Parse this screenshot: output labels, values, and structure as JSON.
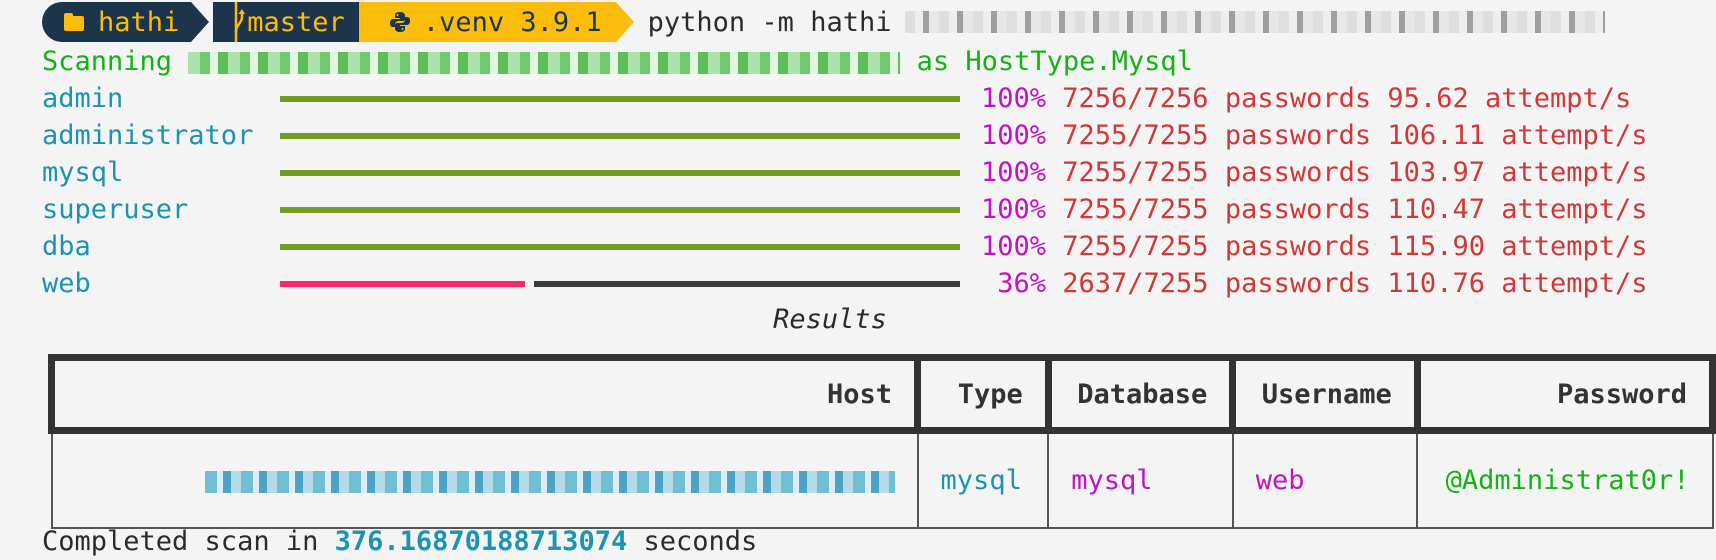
{
  "prompt": {
    "directory": "hathi",
    "directory_icon": "folder-icon",
    "git_branch": "master",
    "git_icon": "git-branch-icon",
    "venv": ".venv 3.9.1",
    "venv_icon": "python-icon",
    "command": "python -m hathi",
    "command_args_redacted": true
  },
  "scan_line": {
    "prefix": "Scanning",
    "target_redacted": true,
    "suffix": "as HostType.Mysql"
  },
  "progress": [
    {
      "username": "admin",
      "percent_label": "100%",
      "fraction": 1.0,
      "count": "7256/7256",
      "unit": "passwords",
      "rate": "95.62",
      "rate_unit": "attempt/s",
      "state": "complete"
    },
    {
      "username": "administrator",
      "percent_label": "100%",
      "fraction": 1.0,
      "count": "7255/7255",
      "unit": "passwords",
      "rate": "106.11",
      "rate_unit": "attempt/s",
      "state": "complete"
    },
    {
      "username": "mysql",
      "percent_label": "100%",
      "fraction": 1.0,
      "count": "7255/7255",
      "unit": "passwords",
      "rate": "103.97",
      "rate_unit": "attempt/s",
      "state": "complete"
    },
    {
      "username": "superuser",
      "percent_label": "100%",
      "fraction": 1.0,
      "count": "7255/7255",
      "unit": "passwords",
      "rate": "110.47",
      "rate_unit": "attempt/s",
      "state": "complete"
    },
    {
      "username": "dba",
      "percent_label": "100%",
      "fraction": 1.0,
      "count": "7255/7255",
      "unit": "passwords",
      "rate": "115.90",
      "rate_unit": "attempt/s",
      "state": "complete"
    },
    {
      "username": "web",
      "percent_label": "36%",
      "fraction": 0.36,
      "count": "2637/7255",
      "unit": "passwords",
      "rate": "110.76",
      "rate_unit": "attempt/s",
      "state": "in-progress"
    }
  ],
  "colors": {
    "bar_complete": "#729c23",
    "bar_in_progress": "#f92672",
    "bar_remaining": "#3a3a3a",
    "prompt_dark": "#1c354d",
    "prompt_accent": "#fbbc0b"
  },
  "results": {
    "title": "Results",
    "columns": [
      "Host",
      "Type",
      "Database",
      "Username",
      "Password"
    ],
    "rows": [
      {
        "host_redacted": true,
        "type": "mysql",
        "database": "mysql",
        "username": "web",
        "password": "@Administrat0r!"
      }
    ]
  },
  "footer": {
    "prefix": "Completed scan in",
    "seconds": "376.16870188713074",
    "suffix": "seconds"
  }
}
